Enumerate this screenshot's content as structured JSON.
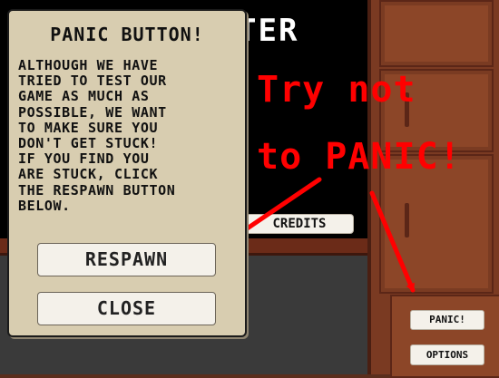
{
  "background": {
    "board_title": "TER",
    "credits_label": "CREDITS"
  },
  "cabinet": {
    "panic_label": "PANIC!",
    "options_label": "OPTIONS"
  },
  "annotation": {
    "text": "Try not\nto PANIC!",
    "color": "#ff0000"
  },
  "modal": {
    "title": "PANIC BUTTON!",
    "body": "ALTHOUGH WE HAVE\nTRIED TO TEST OUR\nGAME AS MUCH AS\nPOSSIBLE, WE WANT\nTO MAKE SURE YOU\nDON'T GET STUCK!\nIF YOU FIND YOU\nARE STUCK, CLICK\nTHE RESPAWN BUTTON\nBELOW.",
    "respawn_label": "RESPAWN",
    "close_label": "CLOSE"
  }
}
